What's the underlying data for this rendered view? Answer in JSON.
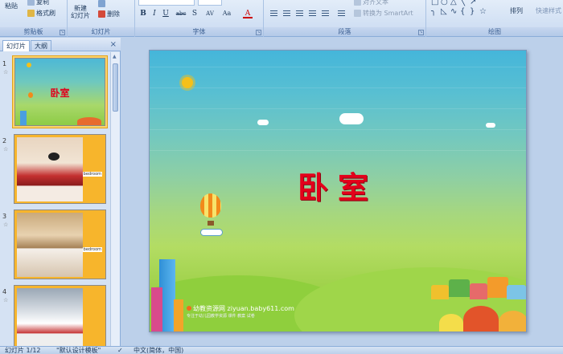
{
  "ribbon": {
    "clipboard": {
      "paste_label": "粘贴",
      "copy_label": "复制",
      "format_painter_label": "格式刷",
      "group_label": "剪贴板"
    },
    "slides": {
      "new_slide_label_1": "新建",
      "new_slide_label_2": "幻灯片",
      "delete_label": "删除",
      "group_label": "幻灯片"
    },
    "font": {
      "group_label": "字体",
      "bold": "B",
      "italic": "I",
      "underline": "U",
      "strikethrough": "abc",
      "shadow": "S",
      "spacing": "AV",
      "case": "Aa",
      "font_color": "A"
    },
    "paragraph": {
      "group_label": "段落",
      "align_text_label": "对齐文本",
      "smartart_label": "转换为 SmartArt"
    },
    "drawing": {
      "group_label": "绘图",
      "arrange_label": "排列",
      "quick_styles_label": "快速样式"
    }
  },
  "left_pane": {
    "tabs": [
      {
        "label": "幻灯片"
      },
      {
        "label": "大纲"
      }
    ],
    "close": "×",
    "thumbnails": [
      {
        "number": "1",
        "title": "卧室"
      },
      {
        "number": "2",
        "tag": "bedroom"
      },
      {
        "number": "3",
        "tag": "bedroom"
      },
      {
        "number": "4"
      }
    ]
  },
  "slide": {
    "title": "卧室",
    "watermark": "幼教资源网 ziyuan.baby611.com",
    "watermark_sub": "专注于幼儿园教学资源 课件 教案 试卷"
  },
  "statusbar": {
    "slide_pos": "幻灯片 1/12",
    "theme": "\"默认设计模板\"",
    "language": "中文(简体，中国)"
  },
  "colors": {
    "title_red": "#e3001b",
    "ribbon_bg": "#dbe7f6",
    "selection": "#fbd46a"
  }
}
